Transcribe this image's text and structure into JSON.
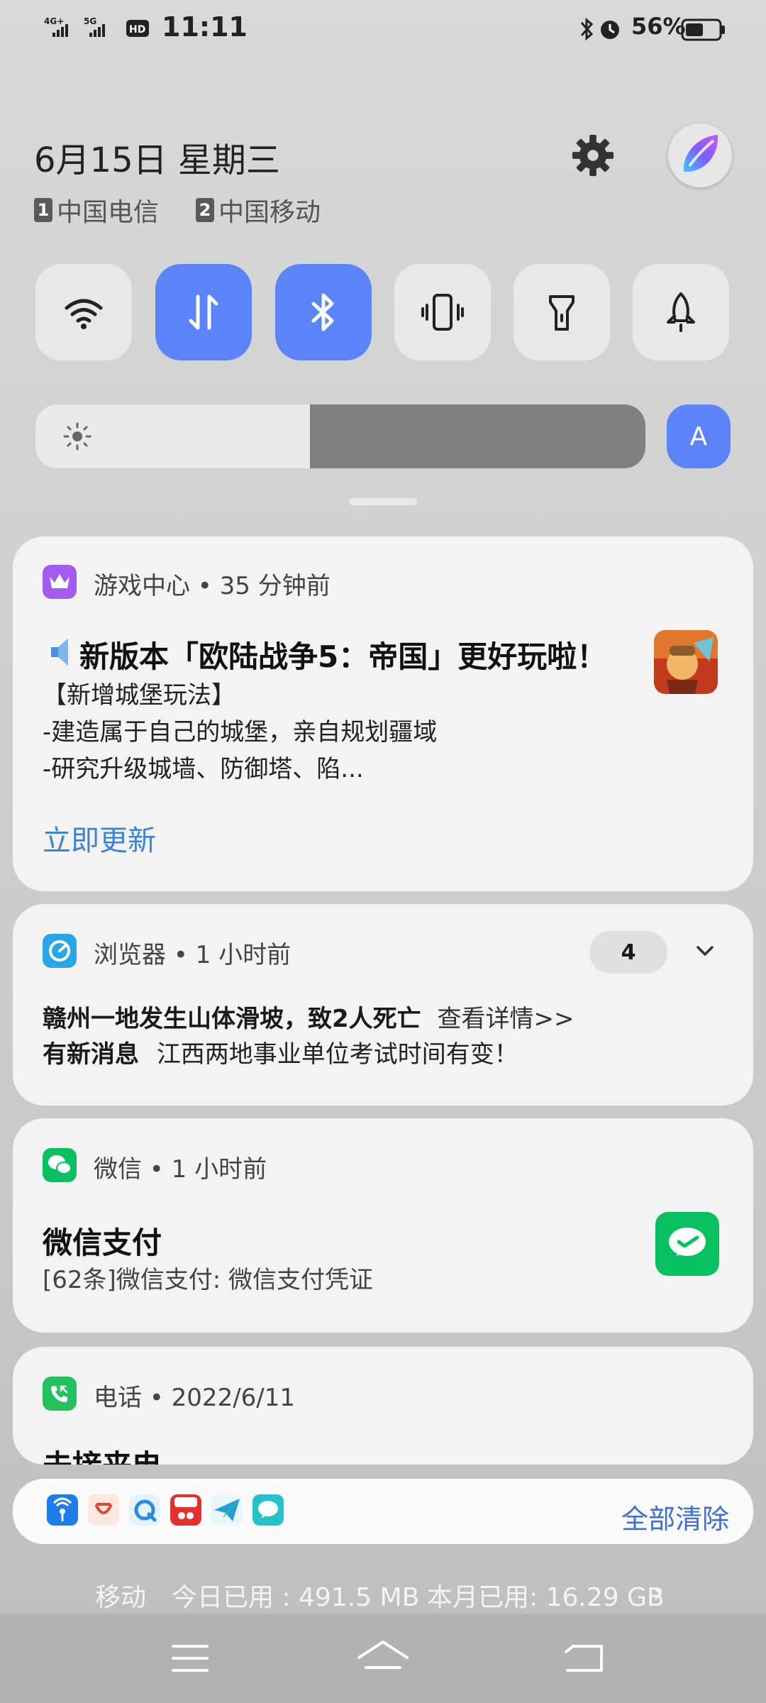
{
  "status": {
    "left_text": "4G⁺ 5G HD₂",
    "time": "11:11",
    "battery": "56%"
  },
  "header": {
    "date": "6月15日 星期三",
    "sim1_num": "1",
    "sim1_name": "中国电信",
    "sim2_num": "2",
    "sim2_name": "中国移动"
  },
  "toggles": [
    {
      "icon": "wifi-icon",
      "on": false
    },
    {
      "icon": "mobile-data-icon",
      "on": true
    },
    {
      "icon": "bluetooth-icon",
      "on": true
    },
    {
      "icon": "vibrate-icon",
      "on": false
    },
    {
      "icon": "flashlight-icon",
      "on": false
    },
    {
      "icon": "airplane-icon",
      "on": false
    }
  ],
  "brightness": {
    "level": 0.45,
    "auto_label": "A"
  },
  "notifications": {
    "game": {
      "meta": "游戏中心 • 35 分钟前",
      "title": "新版本「欧陆战争5：帝国」更好玩啦！",
      "line1": "【新增城堡玩法】",
      "line2": "-建造属于自己的城堡，亲自规划疆域",
      "line3": "-研究升级城墙、防御塔、陷...",
      "action": "立即更新"
    },
    "browser": {
      "meta": "浏览器 • 1 小时前",
      "count": "4",
      "line1_bold": "赣州一地发生山体滑坡，致2人死亡",
      "line1_link": "查看详情>>",
      "line2_bold": "有新消息",
      "line2_text": "江西两地事业单位考试时间有变！"
    },
    "wechat": {
      "meta": "微信 • 1 小时前",
      "title": "微信支付",
      "text": "[62条]微信支付: 微信支付凭证"
    },
    "phone": {
      "meta": "电话 • 2022/6/11",
      "title": "未接来电"
    }
  },
  "bottom": {
    "clear_all": "全部清除"
  },
  "data_usage": {
    "carrier": "移动",
    "today": "今日已用 : 491.5 MB",
    "month": "本月已用: 16.29 GB",
    "arrow": "›"
  },
  "colors": {
    "accent": "#5b84fb",
    "link": "#3d83d9",
    "wechat": "#07c160"
  }
}
